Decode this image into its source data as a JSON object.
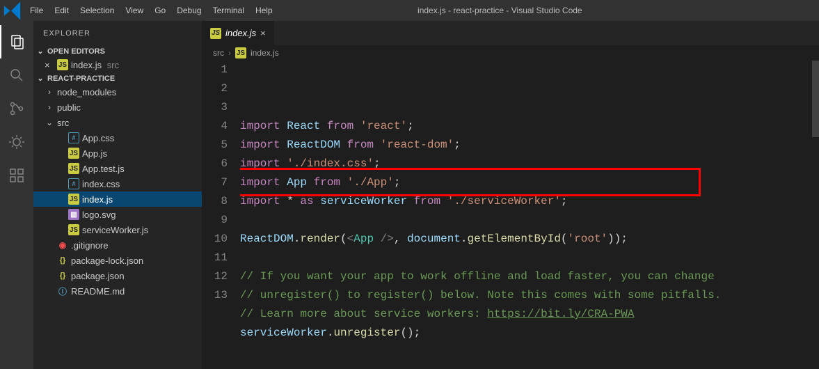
{
  "titlebar": {
    "title": "index.js - react-practice - Visual Studio Code",
    "menu": [
      "File",
      "Edit",
      "Selection",
      "View",
      "Go",
      "Debug",
      "Terminal",
      "Help"
    ]
  },
  "activitybar": [
    {
      "name": "explorer-icon",
      "active": true
    },
    {
      "name": "search-icon",
      "active": false
    },
    {
      "name": "scm-icon",
      "active": false
    },
    {
      "name": "debug-icon",
      "active": false
    },
    {
      "name": "extensions-icon",
      "active": false
    }
  ],
  "sidebar": {
    "title": "EXPLORER",
    "open_editors": {
      "label": "OPEN EDITORS",
      "items": [
        {
          "icon": "js",
          "name": "index.js",
          "hint": "src",
          "dirty": false
        }
      ]
    },
    "project": {
      "label": "REACT-PRACTICE",
      "tree": [
        {
          "depth": 0,
          "type": "folder",
          "expanded": false,
          "name": "node_modules"
        },
        {
          "depth": 0,
          "type": "folder",
          "expanded": false,
          "name": "public"
        },
        {
          "depth": 0,
          "type": "folder",
          "expanded": true,
          "name": "src"
        },
        {
          "depth": 1,
          "type": "file",
          "icon": "css",
          "name": "App.css"
        },
        {
          "depth": 1,
          "type": "file",
          "icon": "js",
          "name": "App.js"
        },
        {
          "depth": 1,
          "type": "file",
          "icon": "js",
          "name": "App.test.js"
        },
        {
          "depth": 1,
          "type": "file",
          "icon": "css",
          "name": "index.css"
        },
        {
          "depth": 1,
          "type": "file",
          "icon": "js",
          "name": "index.js",
          "selected": true
        },
        {
          "depth": 1,
          "type": "file",
          "icon": "svg",
          "name": "logo.svg"
        },
        {
          "depth": 1,
          "type": "file",
          "icon": "js",
          "name": "serviceWorker.js"
        },
        {
          "depth": 0,
          "type": "file",
          "icon": "ignore",
          "name": ".gitignore"
        },
        {
          "depth": 0,
          "type": "file",
          "icon": "json",
          "name": "package-lock.json"
        },
        {
          "depth": 0,
          "type": "file",
          "icon": "json",
          "name": "package.json"
        },
        {
          "depth": 0,
          "type": "file",
          "icon": "info",
          "name": "README.md"
        }
      ]
    }
  },
  "tab": {
    "icon": "js",
    "name": "index.js"
  },
  "breadcrumbs": [
    "src",
    "index.js"
  ],
  "code": {
    "lines": [
      [
        [
          "kw",
          "import"
        ],
        [
          "",
          ""
        ],
        [
          "var",
          " React "
        ],
        [
          "kw",
          "from"
        ],
        [
          "",
          " "
        ],
        [
          "str",
          "'react'"
        ],
        [
          "",
          ";"
        ]
      ],
      [
        [
          "kw",
          "import"
        ],
        [
          "",
          ""
        ],
        [
          "var",
          " ReactDOM "
        ],
        [
          "kw",
          "from"
        ],
        [
          "",
          " "
        ],
        [
          "str",
          "'react-dom'"
        ],
        [
          "",
          ";"
        ]
      ],
      [
        [
          "kw",
          "import"
        ],
        [
          "",
          " "
        ],
        [
          "str",
          "'./index.css'"
        ],
        [
          "",
          ";"
        ]
      ],
      [
        [
          "kw",
          "import"
        ],
        [
          "",
          ""
        ],
        [
          "var",
          " App "
        ],
        [
          "kw",
          "from"
        ],
        [
          "",
          " "
        ],
        [
          "str",
          "'./App'"
        ],
        [
          "",
          ";"
        ]
      ],
      [
        [
          "kw",
          "import"
        ],
        [
          "",
          " "
        ],
        [
          "",
          "* "
        ],
        [
          "kw",
          "as"
        ],
        [
          "",
          " "
        ],
        [
          "var",
          "serviceWorker"
        ],
        [
          "",
          " "
        ],
        [
          "kw",
          "from"
        ],
        [
          "",
          " "
        ],
        [
          "str",
          "'./serviceWorker'"
        ],
        [
          "",
          ";"
        ]
      ],
      [
        [
          "",
          ""
        ]
      ],
      [
        [
          "var",
          "ReactDOM"
        ],
        [
          "",
          "."
        ],
        [
          "fn",
          "render"
        ],
        [
          "",
          "("
        ],
        [
          "tag",
          "<"
        ],
        [
          "comp",
          "App"
        ],
        [
          "",
          " "
        ],
        [
          "tag",
          "/>"
        ],
        [
          "",
          ", "
        ],
        [
          "var",
          "document"
        ],
        [
          "",
          "."
        ],
        [
          "fn",
          "getElementById"
        ],
        [
          "",
          "("
        ],
        [
          "str",
          "'root'"
        ],
        [
          "",
          ")"
        ],
        [
          "",
          ");"
        ]
      ],
      [
        [
          "",
          ""
        ]
      ],
      [
        [
          "comm",
          "// If you want your app to work offline and load faster, you can change"
        ]
      ],
      [
        [
          "comm",
          "// unregister() to register() below. Note this comes with some pitfalls."
        ]
      ],
      [
        [
          "comm",
          "// Learn more about service workers: "
        ],
        [
          "link",
          "https://bit.ly/CRA-PWA"
        ]
      ],
      [
        [
          "var",
          "serviceWorker"
        ],
        [
          "",
          "."
        ],
        [
          "fn",
          "unregister"
        ],
        [
          "",
          "();"
        ]
      ],
      [
        [
          "",
          ""
        ]
      ]
    ]
  },
  "highlight": {
    "line": 7
  }
}
